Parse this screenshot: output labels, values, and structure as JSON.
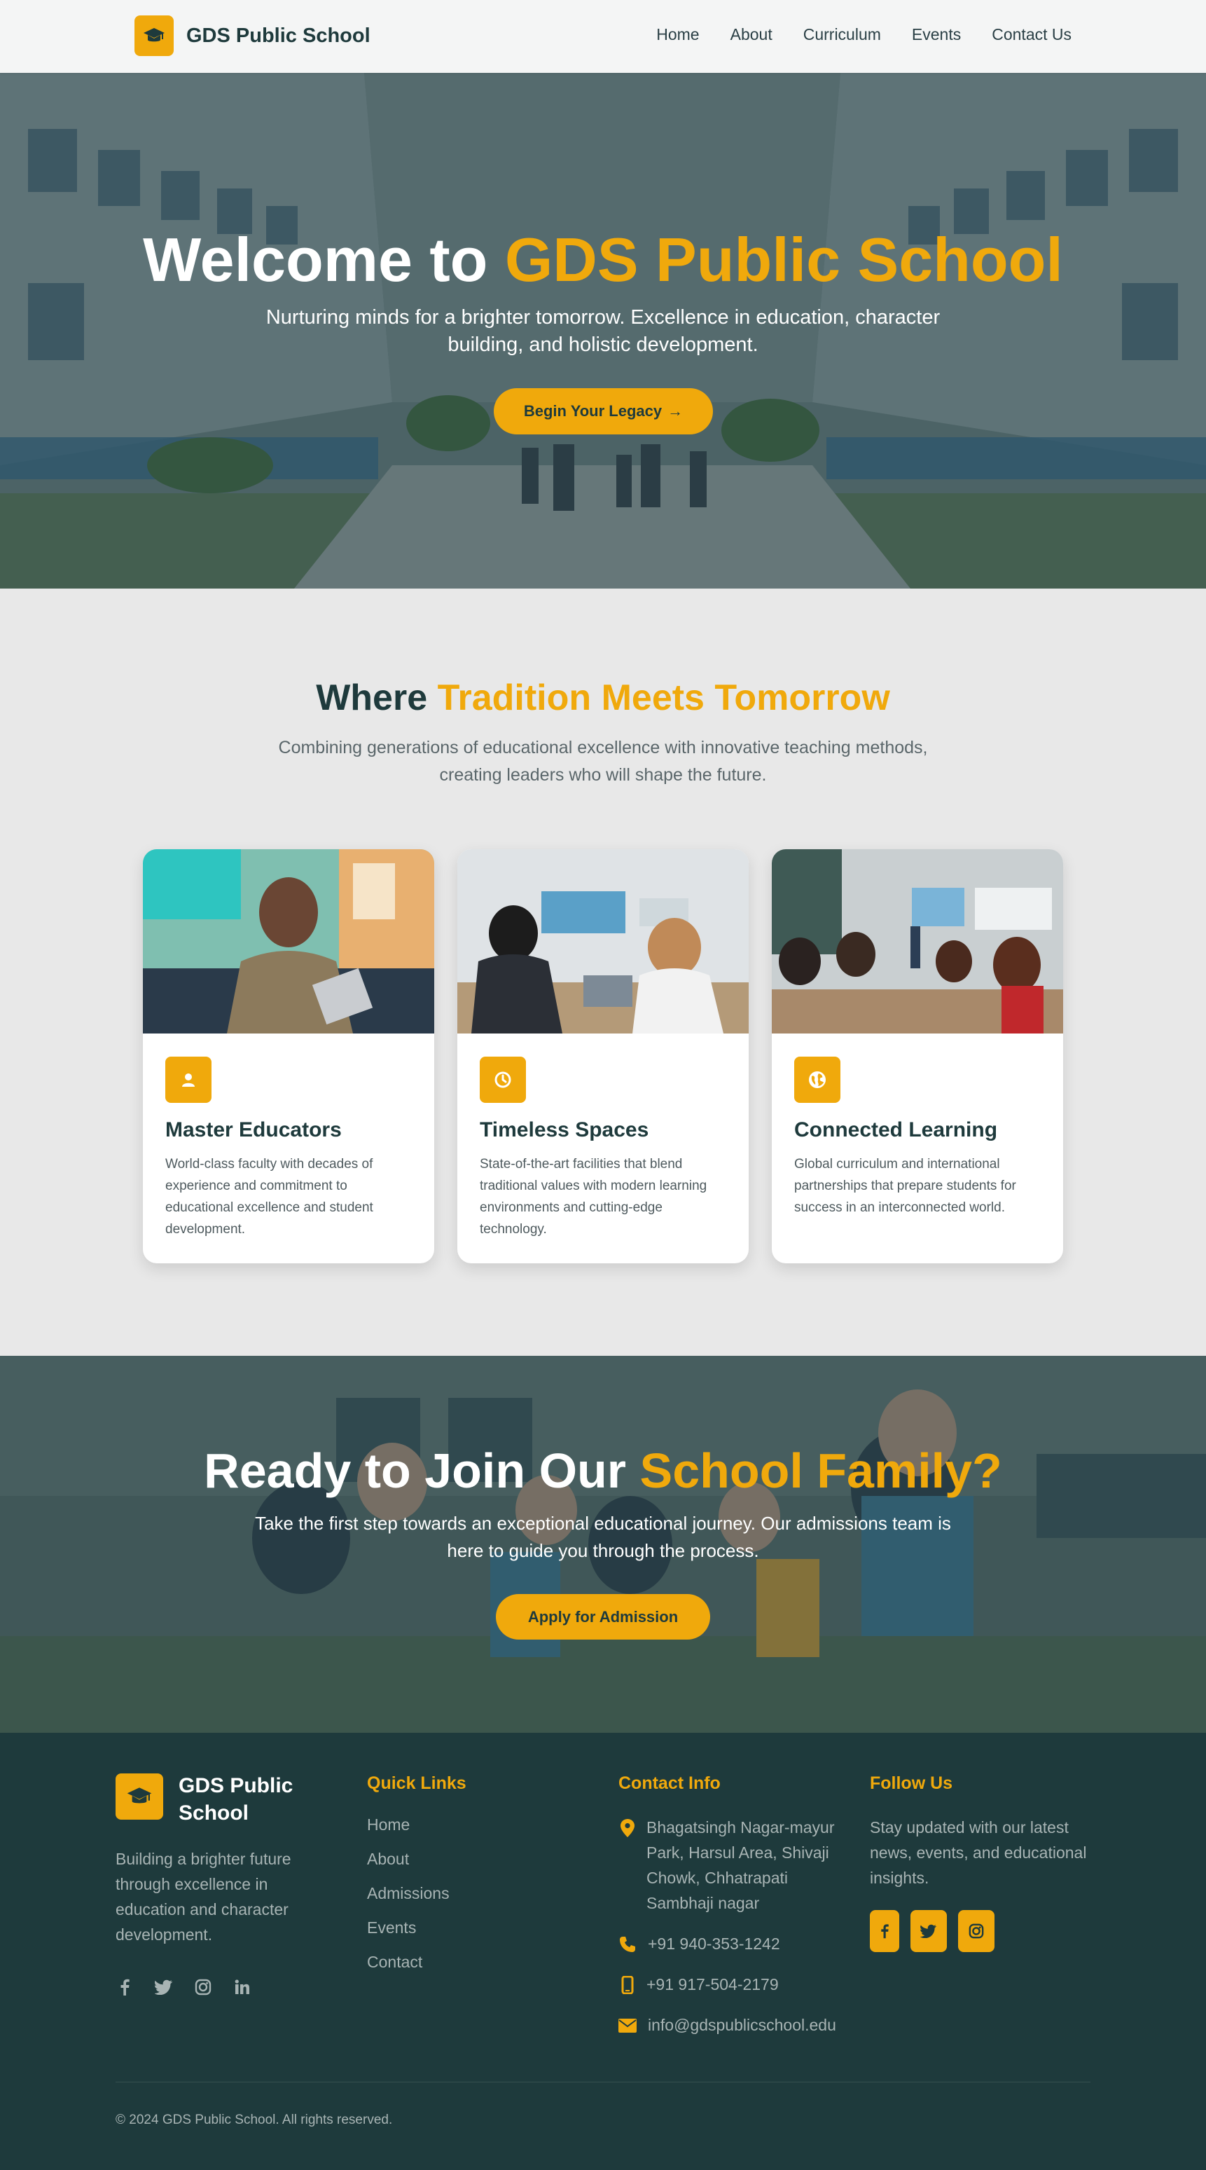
{
  "nav": {
    "brand": "GDS Public School",
    "links": [
      "Home",
      "About",
      "Curriculum",
      "Events",
      "Contact Us"
    ]
  },
  "hero": {
    "title_prefix": "Welcome to",
    "title_accent": "GDS Public School",
    "subtitle": "Nurturing minds for a brighter tomorrow. Excellence in education, character building, and holistic development.",
    "button": "Begin Your Legacy",
    "button_arrow": "→"
  },
  "tradition": {
    "title_prefix": "Where",
    "title_accent": "Tradition Meets Tomorrow",
    "subtitle": "Combining generations of educational excellence with innovative teaching methods, creating leaders who will shape the future."
  },
  "cards": [
    {
      "icon": "user-icon",
      "title": "Master Educators",
      "text": "World-class faculty with decades of experience and commitment to educational excellence and student development."
    },
    {
      "icon": "clock-icon",
      "title": "Timeless Spaces",
      "text": "State-of-the-art facilities that blend traditional values with modern learning environments and cutting-edge technology."
    },
    {
      "icon": "globe-icon",
      "title": "Connected Learning",
      "text": "Global curriculum and international partnerships that prepare students for success in an interconnected world."
    }
  ],
  "cta": {
    "title_prefix": "Ready to Join Our",
    "title_accent": "School Family?",
    "subtitle": "Take the first step towards an exceptional educational journey. Our admissions team is here to guide you through the process.",
    "button": "Apply for Admission"
  },
  "footer": {
    "brand": "GDS Public School",
    "about": "Building a brighter future through excellence in education and character development.",
    "quick_links_title": "Quick Links",
    "quick_links": [
      "Home",
      "About",
      "Admissions",
      "Events",
      "Contact"
    ],
    "contact_title": "Contact Info",
    "address": "Bhagatsingh Nagar-mayur Park, Harsul Area, Shivaji Chowk, Chhatrapati Sambhaji nagar",
    "phone1": "+91 940-353-1242",
    "phone2": "+91 917-504-2179",
    "email": "info@gdspublicschool.edu",
    "follow_title": "Follow Us",
    "follow_text": "Stay updated with our latest news, events, and educational insights.",
    "copyright": "© 2024 GDS Public School. All rights reserved."
  },
  "colors": {
    "accent": "#f0a90c",
    "dark": "#1e3a3c",
    "footer_text": "#a8b4b4"
  }
}
